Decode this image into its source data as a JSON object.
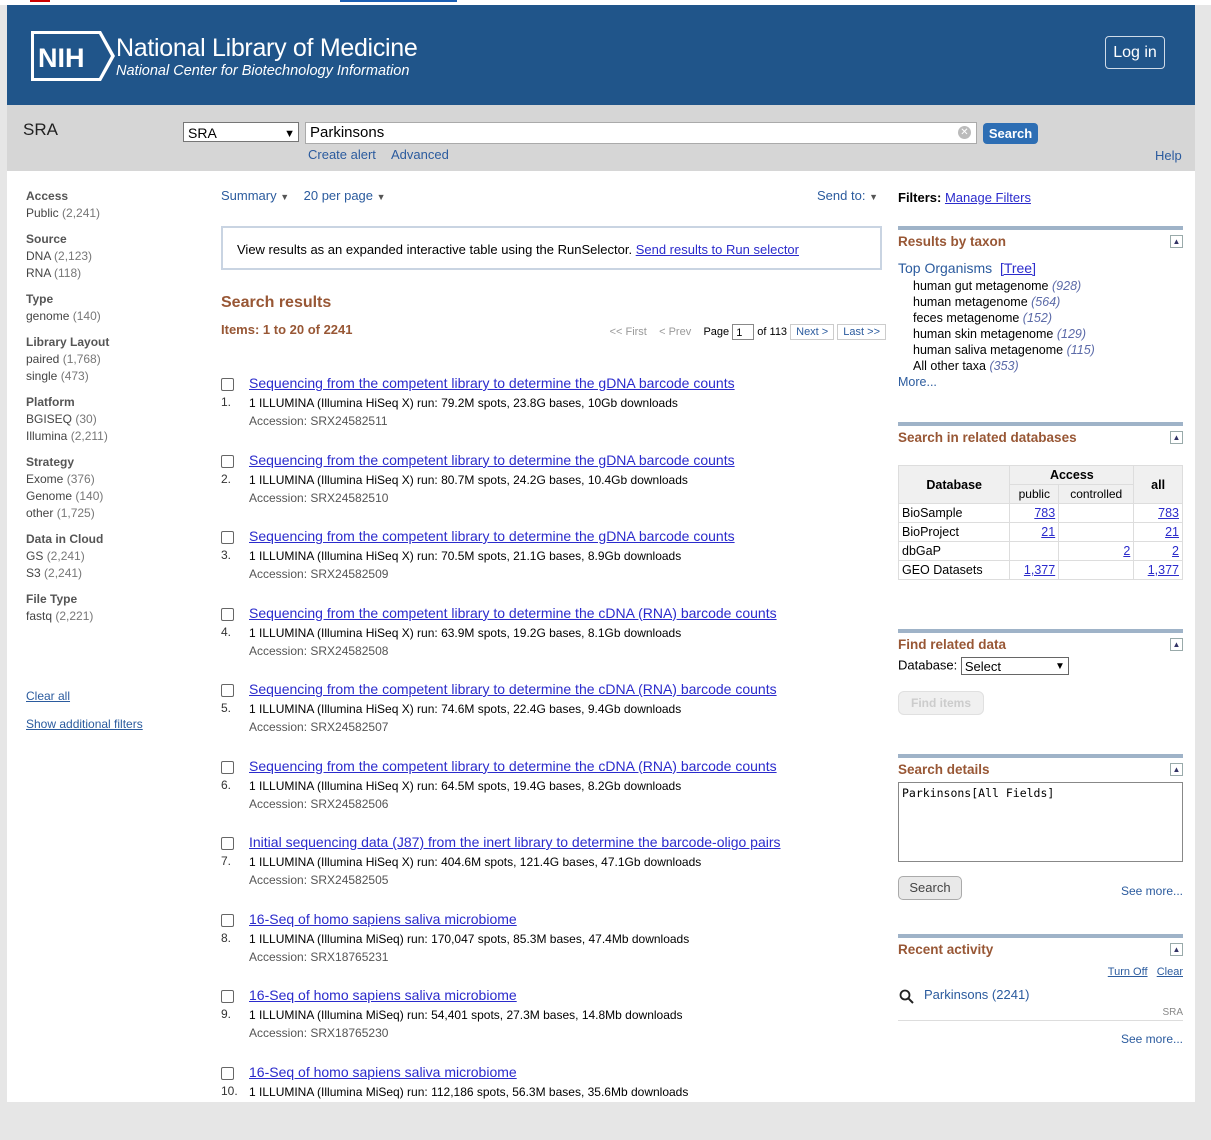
{
  "header": {
    "logo_text": "NIH",
    "title": "National Library of Medicine",
    "subtitle": "National Center for Biotechnology Information",
    "login_label": "Log in"
  },
  "search": {
    "db_name": "SRA",
    "db_select": "SRA",
    "query": "Parkinsons",
    "search_label": "Search",
    "create_alert": "Create alert",
    "advanced": "Advanced",
    "help": "Help"
  },
  "filters": [
    {
      "head": "Access",
      "items": [
        {
          "label": "Public",
          "count": "(2,241)"
        }
      ]
    },
    {
      "head": "Source",
      "items": [
        {
          "label": "DNA",
          "count": "(2,123)"
        },
        {
          "label": "RNA",
          "count": "(118)"
        }
      ]
    },
    {
      "head": "Type",
      "items": [
        {
          "label": "genome",
          "count": "(140)"
        }
      ]
    },
    {
      "head": "Library Layout",
      "items": [
        {
          "label": "paired",
          "count": "(1,768)"
        },
        {
          "label": "single",
          "count": "(473)"
        }
      ]
    },
    {
      "head": "Platform",
      "items": [
        {
          "label": "BGISEQ",
          "count": "(30)"
        },
        {
          "label": "Illumina",
          "count": "(2,211)"
        }
      ]
    },
    {
      "head": "Strategy",
      "items": [
        {
          "label": "Exome",
          "count": "(376)"
        },
        {
          "label": "Genome",
          "count": "(140)"
        },
        {
          "label": "other",
          "count": "(1,725)"
        }
      ]
    },
    {
      "head": "Data in Cloud",
      "items": [
        {
          "label": "GS",
          "count": "(2,241)"
        },
        {
          "label": "S3",
          "count": "(2,241)"
        }
      ]
    },
    {
      "head": "File Type",
      "items": [
        {
          "label": "fastq",
          "count": "(2,221)"
        }
      ]
    }
  ],
  "left_links": {
    "clear_all": "Clear all",
    "show_filters": "Show additional filters"
  },
  "toolbar": {
    "summary": "Summary",
    "per_page": "20 per page",
    "send_to": "Send to:"
  },
  "runselector": {
    "text": "View results as an expanded interactive table using the RunSelector.",
    "link": "Send results to Run selector"
  },
  "results_header": {
    "title": "Search results",
    "items": "Items: 1 to 20 of 2241"
  },
  "pager": {
    "first": "<< First",
    "prev": "< Prev",
    "page_label": "Page",
    "page": "1",
    "of": "of 113",
    "next": "Next >",
    "last": "Last >>"
  },
  "results": [
    {
      "num": "1.",
      "title": "Sequencing from the competent library to determine the gDNA barcode counts",
      "desc": "1 ILLUMINA (Illumina HiSeq X) run: 79.2M spots, 23.8G bases, 10Gb downloads",
      "acc": "Accession: SRX24582511"
    },
    {
      "num": "2.",
      "title": "Sequencing from the competent library to determine the gDNA barcode counts",
      "desc": "1 ILLUMINA (Illumina HiSeq X) run: 80.7M spots, 24.2G bases, 10.4Gb downloads",
      "acc": "Accession: SRX24582510"
    },
    {
      "num": "3.",
      "title": "Sequencing from the competent library to determine the gDNA barcode counts",
      "desc": "1 ILLUMINA (Illumina HiSeq X) run: 70.5M spots, 21.1G bases, 8.9Gb downloads",
      "acc": "Accession: SRX24582509"
    },
    {
      "num": "4.",
      "title": "Sequencing from the competent library to determine the cDNA (RNA) barcode counts",
      "desc": "1 ILLUMINA (Illumina HiSeq X) run: 63.9M spots, 19.2G bases, 8.1Gb downloads",
      "acc": "Accession: SRX24582508"
    },
    {
      "num": "5.",
      "title": "Sequencing from the competent library to determine the cDNA (RNA) barcode counts",
      "desc": "1 ILLUMINA (Illumina HiSeq X) run: 74.6M spots, 22.4G bases, 9.4Gb downloads",
      "acc": "Accession: SRX24582507"
    },
    {
      "num": "6.",
      "title": "Sequencing from the competent library to determine the cDNA (RNA) barcode counts",
      "desc": "1 ILLUMINA (Illumina HiSeq X) run: 64.5M spots, 19.4G bases, 8.2Gb downloads",
      "acc": "Accession: SRX24582506"
    },
    {
      "num": "7.",
      "title": "Initial sequencing data (J87) from the inert library to determine the barcode-oligo pairs",
      "desc": "1 ILLUMINA (Illumina HiSeq X) run: 404.6M spots, 121.4G bases, 47.1Gb downloads",
      "acc": "Accession: SRX24582505"
    },
    {
      "num": "8.",
      "title": "16-Seq of homo sapiens saliva microbiome",
      "desc": "1 ILLUMINA (Illumina MiSeq) run: 170,047 spots, 85.3M bases, 47.4Mb downloads",
      "acc": "Accession: SRX18765231"
    },
    {
      "num": "9.",
      "title": "16-Seq of homo sapiens saliva microbiome",
      "desc": "1 ILLUMINA (Illumina MiSeq) run: 54,401 spots, 27.3M bases, 14.8Mb downloads",
      "acc": "Accession: SRX18765230"
    },
    {
      "num": "10.",
      "title": "16-Seq of homo sapiens saliva microbiome",
      "desc": "1 ILLUMINA (Illumina MiSeq) run: 112,186 spots, 56.3M bases, 35.6Mb downloads",
      "acc": ""
    }
  ],
  "right": {
    "filters_label": "Filters:",
    "manage_filters": "Manage Filters",
    "taxon_title": "Results by taxon",
    "top_organisms": "Top Organisms",
    "tree": "[Tree]",
    "taxa": [
      {
        "name": "human gut metagenome",
        "count": "(928)"
      },
      {
        "name": "human metagenome",
        "count": "(564)"
      },
      {
        "name": "feces metagenome",
        "count": "(152)"
      },
      {
        "name": "human skin metagenome",
        "count": "(129)"
      },
      {
        "name": "human saliva metagenome",
        "count": "(115)"
      },
      {
        "name": "All other taxa",
        "count": "(353)"
      }
    ],
    "more": "More...",
    "related_title": "Search in related databases",
    "related_head": {
      "database": "Database",
      "access": "Access",
      "public": "public",
      "controlled": "controlled",
      "all": "all"
    },
    "related_rows": [
      {
        "db": "BioSample",
        "public": "783",
        "controlled": "",
        "all": "783"
      },
      {
        "db": "BioProject",
        "public": "21",
        "controlled": "",
        "all": "21"
      },
      {
        "db": "dbGaP",
        "public": "",
        "controlled": "2",
        "all": "2"
      },
      {
        "db": "GEO Datasets",
        "public": "1,377",
        "controlled": "",
        "all": "1,377"
      }
    ],
    "find_title": "Find related data",
    "database_label": "Database:",
    "database_select": "Select",
    "find_items": "Find items",
    "details_title": "Search details",
    "details_text": "Parkinsons[All Fields]",
    "details_search": "Search",
    "see_more": "See more...",
    "recent_title": "Recent activity",
    "turn_off": "Turn Off",
    "clear": "Clear",
    "recent_item": "Parkinsons (2241)",
    "recent_db": "SRA",
    "recent_see_more": "See more..."
  }
}
